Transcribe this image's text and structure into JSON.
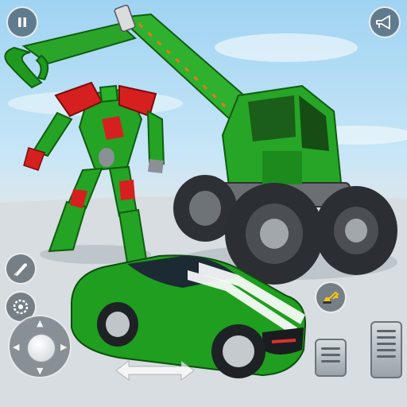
{
  "scene": {
    "description_colors": {
      "vehicle_green": "#1fa31f",
      "robot_red": "#d62020",
      "tire": "#2d3035",
      "ground": "#cfd6db",
      "sky": "#9fd3f2"
    }
  },
  "hud": {
    "pause_icon": "pause-icon",
    "horn_icon": "horn-icon",
    "weapon_icon": "knife-icon",
    "saw_icon": "saw-blade-icon",
    "transform_icon": "excavator-icon",
    "brake_icon": "brake-pedal-icon",
    "gas_icon": "gas-pedal-icon",
    "steer_icon": "left-right-arrows-icon"
  }
}
